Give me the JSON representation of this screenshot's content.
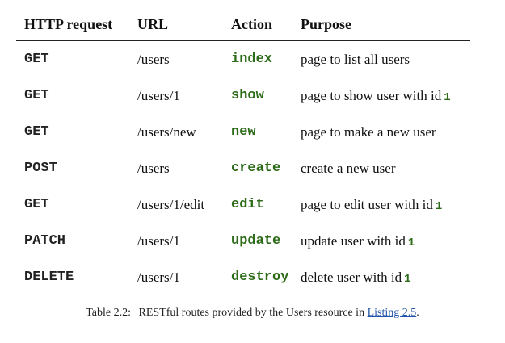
{
  "table": {
    "headers": {
      "method": "HTTP request",
      "url": "URL",
      "action": "Action",
      "purpose": "Purpose"
    },
    "rows": [
      {
        "method": "GET",
        "url": "/users",
        "action": "index",
        "purpose": "page to list all users",
        "id": ""
      },
      {
        "method": "GET",
        "url": "/users/1",
        "action": "show",
        "purpose": "page to show user with id",
        "id": "1"
      },
      {
        "method": "GET",
        "url": "/users/new",
        "action": "new",
        "purpose": "page to make a new user",
        "id": ""
      },
      {
        "method": "POST",
        "url": "/users",
        "action": "create",
        "purpose": "create a new user",
        "id": ""
      },
      {
        "method": "GET",
        "url": "/users/1/edit",
        "action": "edit",
        "purpose": "page to edit user with id",
        "id": "1"
      },
      {
        "method": "PATCH",
        "url": "/users/1",
        "action": "update",
        "purpose": "update user with id",
        "id": "1"
      },
      {
        "method": "DELETE",
        "url": "/users/1",
        "action": "destroy",
        "purpose": "delete user with id",
        "id": "1"
      }
    ]
  },
  "caption": {
    "label": "Table 2.2:",
    "text": "RESTful routes provided by the Users resource in",
    "link": "Listing 2.5",
    "end": "."
  },
  "colors": {
    "action_green": "#2c6b18",
    "link_blue": "#2255aa"
  }
}
